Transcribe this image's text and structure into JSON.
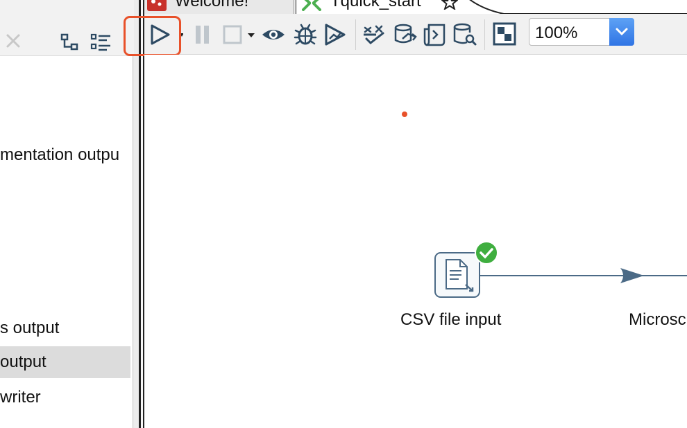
{
  "left_panel": {
    "items": [
      {
        "label": "mentation outpu"
      },
      {
        "label": "s output"
      },
      {
        "label": "output"
      },
      {
        "label": "writer"
      }
    ]
  },
  "tabs": [
    {
      "label": "Welcome!",
      "icon": "welcome-icon"
    },
    {
      "label": "Tquick_start",
      "icon": "transformation-icon"
    }
  ],
  "toolbar": {
    "zoom_value": "100%",
    "buttons": [
      "run-icon",
      "pause-icon",
      "stop-icon",
      "preview-icon",
      "debug-icon",
      "replay-icon",
      "verify-icon",
      "impact-icon",
      "sql-icon",
      "explore-db-icon",
      "show-results-icon"
    ]
  },
  "canvas": {
    "nodes": [
      {
        "label": "CSV file input",
        "status": "ok"
      },
      {
        "label": "Microsc"
      }
    ]
  },
  "colors": {
    "highlight": "#e8512a",
    "node_border": "#4b6a86",
    "status_ok": "#3fae3f",
    "zoom_button": "#3d83ee"
  }
}
